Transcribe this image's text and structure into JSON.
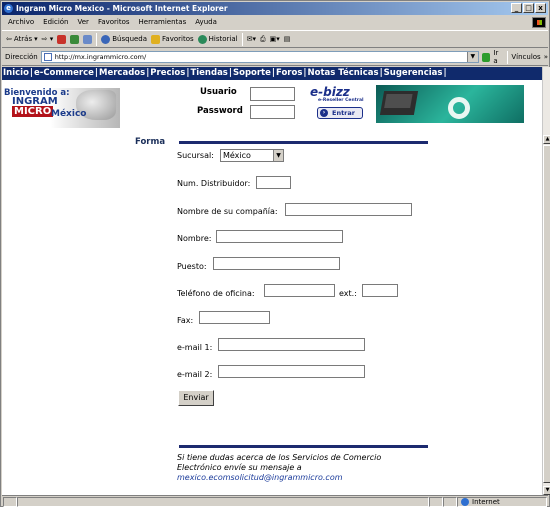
{
  "window": {
    "title": "Ingram Micro Mexico - Microsoft Internet Explorer",
    "minimize": "_",
    "maximize": "□",
    "close": "x"
  },
  "menubar": [
    "Archivo",
    "Edición",
    "Ver",
    "Favoritos",
    "Herramientas",
    "Ayuda"
  ],
  "toolbar": {
    "back": "Atrás",
    "search": "Búsqueda",
    "favorites": "Favoritos",
    "history": "Historial",
    "icon_names": [
      "back-arrow-icon",
      "forward-arrow-icon",
      "stop-icon",
      "refresh-icon",
      "home-icon",
      "search-icon",
      "favorites-icon",
      "history-icon",
      "mail-icon",
      "print-icon",
      "edit-icon",
      "discuss-icon"
    ],
    "colors": {
      "stop": "#c8322a",
      "refresh": "#3a8a3a",
      "home": "#6a8ac8",
      "search": "#3a66b8",
      "favorites": "#e0b020",
      "history": "#2a8a5a"
    }
  },
  "addressbar": {
    "label": "Dirección",
    "url": "http://mx.ingrammicro.com/",
    "go": "Ir a",
    "links": "Vínculos"
  },
  "site_nav": [
    "Inicio",
    "e-Commerce",
    "Mercados",
    "Precios",
    "Tiendas",
    "Soporte",
    "Foros",
    "Notas Técnicas",
    "Sugerencias"
  ],
  "header": {
    "welcome": "Bienvenido a:",
    "brand_top": "INGRAM",
    "brand_bottom": "MICRO",
    "country": "México",
    "user_label": "Usuario",
    "password_label": "Password",
    "ebizz": "e-bizz",
    "ebizz_sub": "e-Reseller Central",
    "enter_button": "Entrar"
  },
  "form": {
    "section": "Forma",
    "sucursal_label": "Sucursal:",
    "sucursal_value": "México",
    "distribuidor_label": "Num. Distribuidor:",
    "compania_label": "Nombre de su compañía:",
    "nombre_label": "Nombre:",
    "puesto_label": "Puesto:",
    "telefono_label": "Teléfono de oficina:",
    "ext_label": "ext.:",
    "fax_label": "Fax:",
    "email1_label": "e-mail 1:",
    "email2_label": "e-mail 2:",
    "submit": "Enviar"
  },
  "footer": {
    "line1": "Si tiene dudas acerca de los Servicios de Comercio",
    "line2": "Electrónico envíe su mensaje a",
    "email": "mexico.ecomsolicitud@ingrammicro.com"
  },
  "status": {
    "zone": "Internet"
  }
}
